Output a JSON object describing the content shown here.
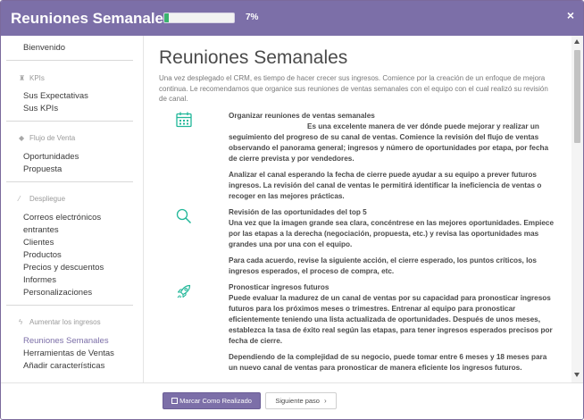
{
  "header": {
    "title": "Reuniones Semanales",
    "progress_fraction": 0.07,
    "progress_label": "7%",
    "close_label": "×"
  },
  "sidebar": {
    "welcome": "Bienvenido",
    "sections": [
      {
        "title": "KPIs",
        "icon": "trophy-icon",
        "items": [
          "Sus Expectativas",
          "Sus KPIs"
        ]
      },
      {
        "title": "Flujo de Venta",
        "icon": "tag-icon",
        "items": [
          "Oportunidades",
          "Propuesta"
        ]
      },
      {
        "title": "Despliegue",
        "icon": "magic-wand-icon",
        "items": [
          "Correos electrónicos",
          "entrantes",
          "Clientes",
          "Productos",
          "Precios y descuentos",
          "Informes",
          "Personalizaciones"
        ]
      },
      {
        "title": "Aumentar los ingresos",
        "icon": "bolt-icon",
        "items": [
          "Reuniones Semanales",
          "Herramientas de Ventas",
          "Añadir características"
        ]
      }
    ],
    "active_item": "Reuniones Semanales"
  },
  "main": {
    "title": "Reuniones Semanales",
    "intro": "Una vez desplegado el CRM, es tiempo de hacer crecer sus ingresos. Comience por la creación de un enfoque de mejora continua. Le recomendamos que organice sus reuniones de ventas semanales con el equipo con el cual realizó su revisión de canal.",
    "blocks": [
      {
        "icon": "calendar-icon",
        "heading": "Organizar reuniones de ventas semanales",
        "indent_text": "Es una excelente manera de ver dónde puede mejorar y realizar un",
        "text": "seguimiento del progreso de su canal de ventas. Comience la revisión del flujo de ventas observando el panorama general; ingresos y número de oportunidades por etapa, por fecha de cierre prevista y por vendedores."
      },
      {
        "icon": "",
        "heading": "",
        "indent_text": "",
        "text": "Analizar el canal esperando la fecha de cierre puede ayudar a su equipo a prever futuros ingresos. La revisión del canal de ventas le permitirá identificar la ineficiencia de ventas o recoger en las mejores prácticas."
      },
      {
        "icon": "search-icon",
        "heading": "Revisión de las oportunidades del top 5",
        "indent_text": "",
        "text": "Una vez que la imagen grande sea clara, concéntrese en las mejores oportunidades. Empiece por las etapas a la derecha (negociación, propuesta, etc.) y revisa las oportunidades mas grandes una por una con el equipo."
      },
      {
        "icon": "",
        "heading": "",
        "indent_text": "",
        "text": "Para cada acuerdo, revise la siguiente acción, el cierre esperado, los puntos críticos, los ingresos esperados, el proceso de compra, etc."
      },
      {
        "icon": "rocket-icon",
        "heading": "Pronosticar ingresos futuros",
        "indent_text": "",
        "text": "Puede evaluar la madurez de un canal de ventas por su capacidad para pronosticar ingresos futuros para los próximos meses o trimestres. Entrenar al equipo para pronosticar eficientemente teniendo una lista actualizada de oportunidades. Después de unos meses, establezca la tasa de éxito real según las etapas, para tener ingresos esperados precisos por fecha de cierre."
      },
      {
        "icon": "",
        "heading": "",
        "indent_text": "",
        "text": "Dependiendo de la complejidad de su negocio, puede tomar entre 6 meses y 18 meses para un nuevo canal de ventas para pronosticar de manera eficiente los ingresos futuros."
      }
    ]
  },
  "footer": {
    "primary_label": "Marcar Como Realizado",
    "secondary_label": "Siguiente paso",
    "secondary_arrow": "›"
  },
  "colors": {
    "accent": "#7c6fa8",
    "progress": "#3bb36f",
    "icon": "#21b799"
  }
}
